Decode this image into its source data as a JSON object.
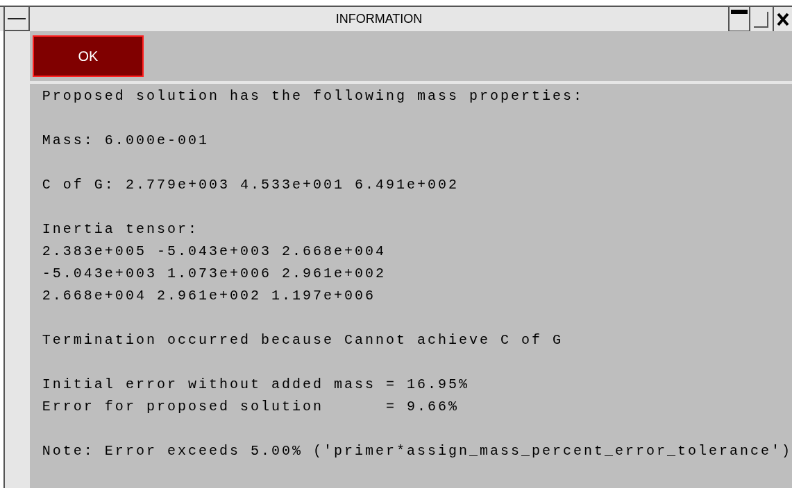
{
  "window": {
    "title": "INFORMATION"
  },
  "buttons": [
    {
      "label": "OK",
      "selected": true
    }
  ],
  "paragraphs": [
    [
      "Proposed solution has the following mass properties:"
    ],
    [
      "Mass: 6.000e-001"
    ],
    [
      "C of G: 2.779e+003 4.533e+001 6.491e+002"
    ],
    [
      "Inertia tensor:",
      "2.383e+005 -5.043e+003 2.668e+004",
      "-5.043e+003 1.073e+006 2.961e+002",
      "2.668e+004 2.961e+002 1.197e+006"
    ],
    [
      "Termination occurred because Cannot achieve C of G"
    ],
    [
      "Initial error without added mass = 16.95%",
      "Error for proposed solution      = 9.66%"
    ],
    [
      "Note: Error exceeds 5.00% ('primer*assign_mass_percent_error_tolerance')"
    ]
  ]
}
